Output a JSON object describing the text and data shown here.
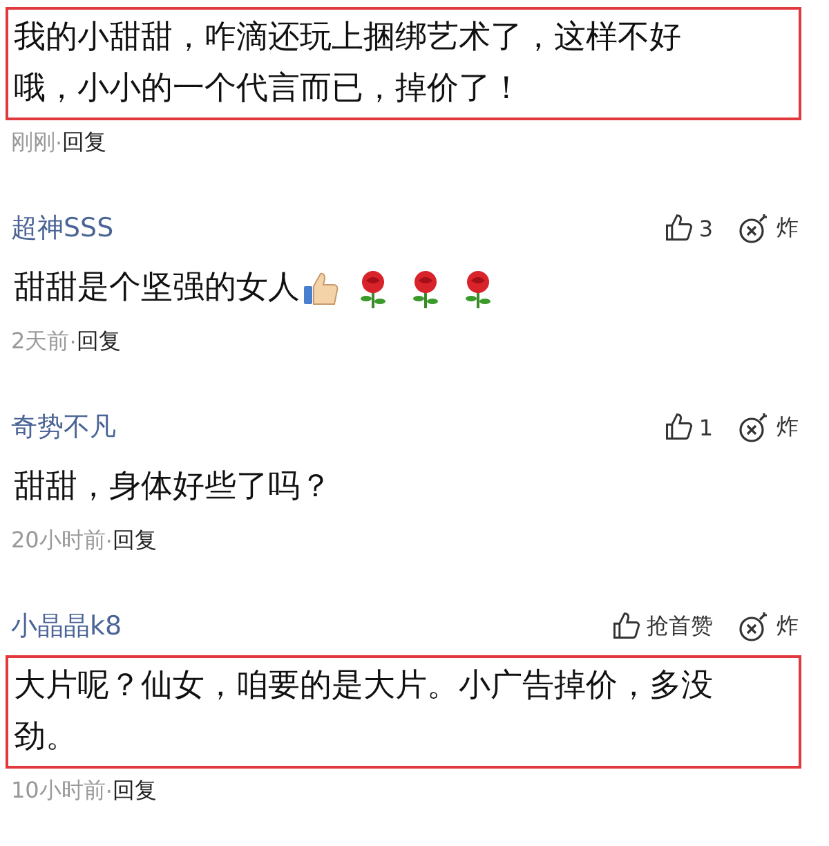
{
  "comments": [
    {
      "text": "我的小甜甜，咋滴还玩上捆绑艺术了，这样不好哦，小小的一个代言而已，掉价了！",
      "highlighted": true,
      "time": "刚刚",
      "separator": "·",
      "reply": "回复"
    },
    {
      "author": "超神SSS",
      "like": "3",
      "bomb": "炸",
      "text": "甜甜是个坚强的女人",
      "emojis": [
        {
          "kind": "thumbs_up"
        },
        {
          "kind": "rose"
        },
        {
          "kind": "rose"
        },
        {
          "kind": "rose"
        }
      ],
      "highlighted": false,
      "time": "2天前",
      "separator": "·",
      "reply": "回复"
    },
    {
      "author": "奇势不凡",
      "like": "1",
      "bomb": "炸",
      "text": "甜甜，身体好些了吗？",
      "highlighted": false,
      "time": "20小时前",
      "separator": "·",
      "reply": "回复"
    },
    {
      "author": "小晶晶k8",
      "like": "抢首赞",
      "bomb": "炸",
      "text": "大片呢？仙女，咱要的是大片。小广告掉价，多没劲。",
      "highlighted": true,
      "time": "10小时前",
      "separator": "·",
      "reply": "回复"
    }
  ]
}
